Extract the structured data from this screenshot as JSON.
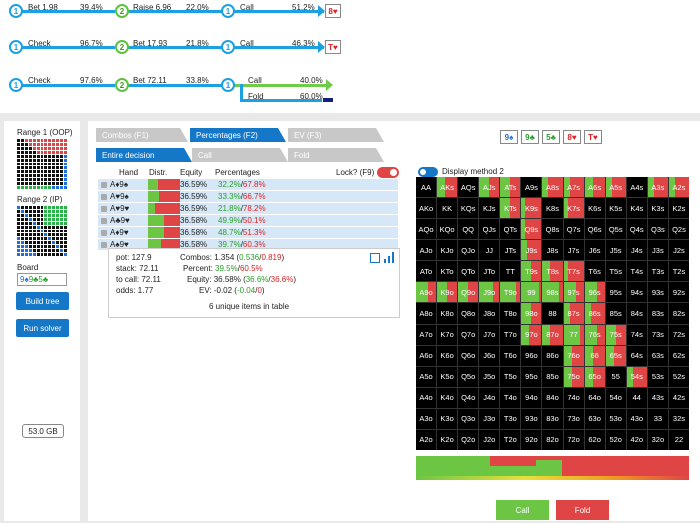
{
  "tree": {
    "row1": {
      "n1": "1",
      "a1": "Bet 1.98",
      "p1": "39.4%",
      "n2": "2",
      "a2": "Raise 6.96",
      "p2": "22.0%",
      "n3": "1",
      "a3": "Call",
      "p3": "51.2%",
      "card": "8♥"
    },
    "row2": {
      "n1": "1",
      "a1": "Check",
      "p1": "96.7%",
      "n2": "2",
      "a2": "Bet 17.93",
      "p2": "21.8%",
      "n3": "1",
      "a3": "Call",
      "p3": "46.3%",
      "card": "T♥"
    },
    "row3": {
      "n1": "1",
      "a1": "Check",
      "p1": "97.6%",
      "n2": "2",
      "a2": "Bet 72.11",
      "p2": "33.8%",
      "n3": "1",
      "a3": "Call",
      "p3": "40.0%",
      "a4": "Fold",
      "p4": "60.0%"
    }
  },
  "left": {
    "range1": "Range 1 (OOP)",
    "range2": "Range 2 (IP)",
    "board_label": "Board",
    "board": [
      "9♠",
      "9♣",
      "5♣"
    ],
    "build_tree": "Build tree",
    "run_solver": "Run solver",
    "memory": "53.0 GB"
  },
  "tabs": {
    "main": [
      "Combos (F1)",
      "Percentages (F2)",
      "EV (F3)"
    ],
    "sub": [
      "Entire decision",
      "Call",
      "Fold"
    ]
  },
  "board_top": [
    "9♠",
    "9♣",
    "5♣",
    "8♥",
    "T♥"
  ],
  "table": {
    "headers": {
      "hand": "Hand",
      "distr": "Distr.",
      "equity": "Equity",
      "percentages": "Percentages",
      "lock": "Lock? (F9)"
    },
    "rows": [
      {
        "hand": "A♦9♠",
        "equity": "36.59%",
        "p1": "32.2%",
        "p2": "67.8%",
        "call": 0.322
      },
      {
        "hand": "A♥9♠",
        "equity": "36.59%",
        "p1": "33.3%",
        "p2": "66.7%",
        "call": 0.333
      },
      {
        "hand": "A♥9♥",
        "equity": "36.59%",
        "p1": "21.8%",
        "p2": "78.2%",
        "call": 0.218
      },
      {
        "hand": "A♣9♥",
        "equity": "36.58%",
        "p1": "49.9%",
        "p2": "50.1%",
        "call": 0.499
      },
      {
        "hand": "A♦9♥",
        "equity": "36.58%",
        "p1": "48.7%",
        "p2": "51.3%",
        "call": 0.487
      },
      {
        "hand": "A♠9♥",
        "equity": "36.58%",
        "p1": "39.7%",
        "p2": "60.3%",
        "call": 0.397
      }
    ]
  },
  "stats": {
    "pot": "pot: 127.9",
    "stack": "stack: 72.11",
    "tocall": "to call: 72.11",
    "odds": "odds: 1.77",
    "combos_label": "Combos:",
    "combos": "1.354",
    "combos_a": "0.536",
    "combos_b": "0.819",
    "percent_label": "Percent:",
    "percent_a": "39.5%",
    "percent_b": "60.5%",
    "equity_label": "Equity:",
    "equity": "36.58%",
    "equity_a": "36.6%",
    "equity_b": "36.6%",
    "ev_label": "EV:",
    "ev": "-0.02",
    "ev_a": "-0.04",
    "ev_b": "0",
    "unique": "6 unique items in table"
  },
  "display_method": "Display method 2",
  "matrix": [
    [
      "AA",
      "AKs",
      "AQs",
      "AJs",
      "ATs",
      "A9s",
      "A8s",
      "A7s",
      "A6s",
      "A5s",
      "A4s",
      "A3s",
      "A2s"
    ],
    [
      "AKo",
      "KK",
      "KQs",
      "KJs",
      "KTs",
      "K9s",
      "K8s",
      "K7s",
      "K6s",
      "K5s",
      "K4s",
      "K3s",
      "K2s"
    ],
    [
      "AQo",
      "KQo",
      "QQ",
      "QJs",
      "QTs",
      "Q9s",
      "Q8s",
      "Q7s",
      "Q6s",
      "Q5s",
      "Q4s",
      "Q3s",
      "Q2s"
    ],
    [
      "AJo",
      "KJo",
      "QJo",
      "JJ",
      "JTs",
      "J9s",
      "J8s",
      "J7s",
      "J6s",
      "J5s",
      "J4s",
      "J3s",
      "J2s"
    ],
    [
      "ATo",
      "KTo",
      "QTo",
      "JTo",
      "TT",
      "T9s",
      "T8s",
      "T7s",
      "T6s",
      "T5s",
      "T4s",
      "T3s",
      "T2s"
    ],
    [
      "A9o",
      "K9o",
      "Q9o",
      "J9o",
      "T9o",
      "99",
      "98s",
      "97s",
      "96s",
      "95s",
      "94s",
      "93s",
      "92s"
    ],
    [
      "A8o",
      "K8o",
      "Q8o",
      "J8o",
      "T8o",
      "98o",
      "88",
      "87s",
      "86s",
      "85s",
      "84s",
      "83s",
      "82s"
    ],
    [
      "A7o",
      "K7o",
      "Q7o",
      "J7o",
      "T7o",
      "97o",
      "87o",
      "77",
      "76s",
      "75s",
      "74s",
      "73s",
      "72s"
    ],
    [
      "A6o",
      "K6o",
      "Q6o",
      "J6o",
      "T6o",
      "96o",
      "86o",
      "76o",
      "66",
      "65s",
      "64s",
      "63s",
      "62s"
    ],
    [
      "A5o",
      "K5o",
      "Q5o",
      "J5o",
      "T5o",
      "95o",
      "85o",
      "75o",
      "65o",
      "55",
      "54s",
      "53s",
      "52s"
    ],
    [
      "A4o",
      "K4o",
      "Q4o",
      "J4o",
      "T4o",
      "94o",
      "84o",
      "74o",
      "64o",
      "54o",
      "44",
      "43s",
      "42s"
    ],
    [
      "A3o",
      "K3o",
      "Q3o",
      "J3o",
      "T3o",
      "93o",
      "83o",
      "73o",
      "63o",
      "53o",
      "43o",
      "33",
      "32s"
    ],
    [
      "A2o",
      "K2o",
      "Q2o",
      "J2o",
      "T2o",
      "92o",
      "82o",
      "72o",
      "62o",
      "52o",
      "42o",
      "32o",
      "22"
    ]
  ],
  "buttons": {
    "call": "Call",
    "fold": "Fold"
  },
  "colors": {
    "call": "#6cc644",
    "fold": "#e04545",
    "accent": "#1577c8"
  }
}
